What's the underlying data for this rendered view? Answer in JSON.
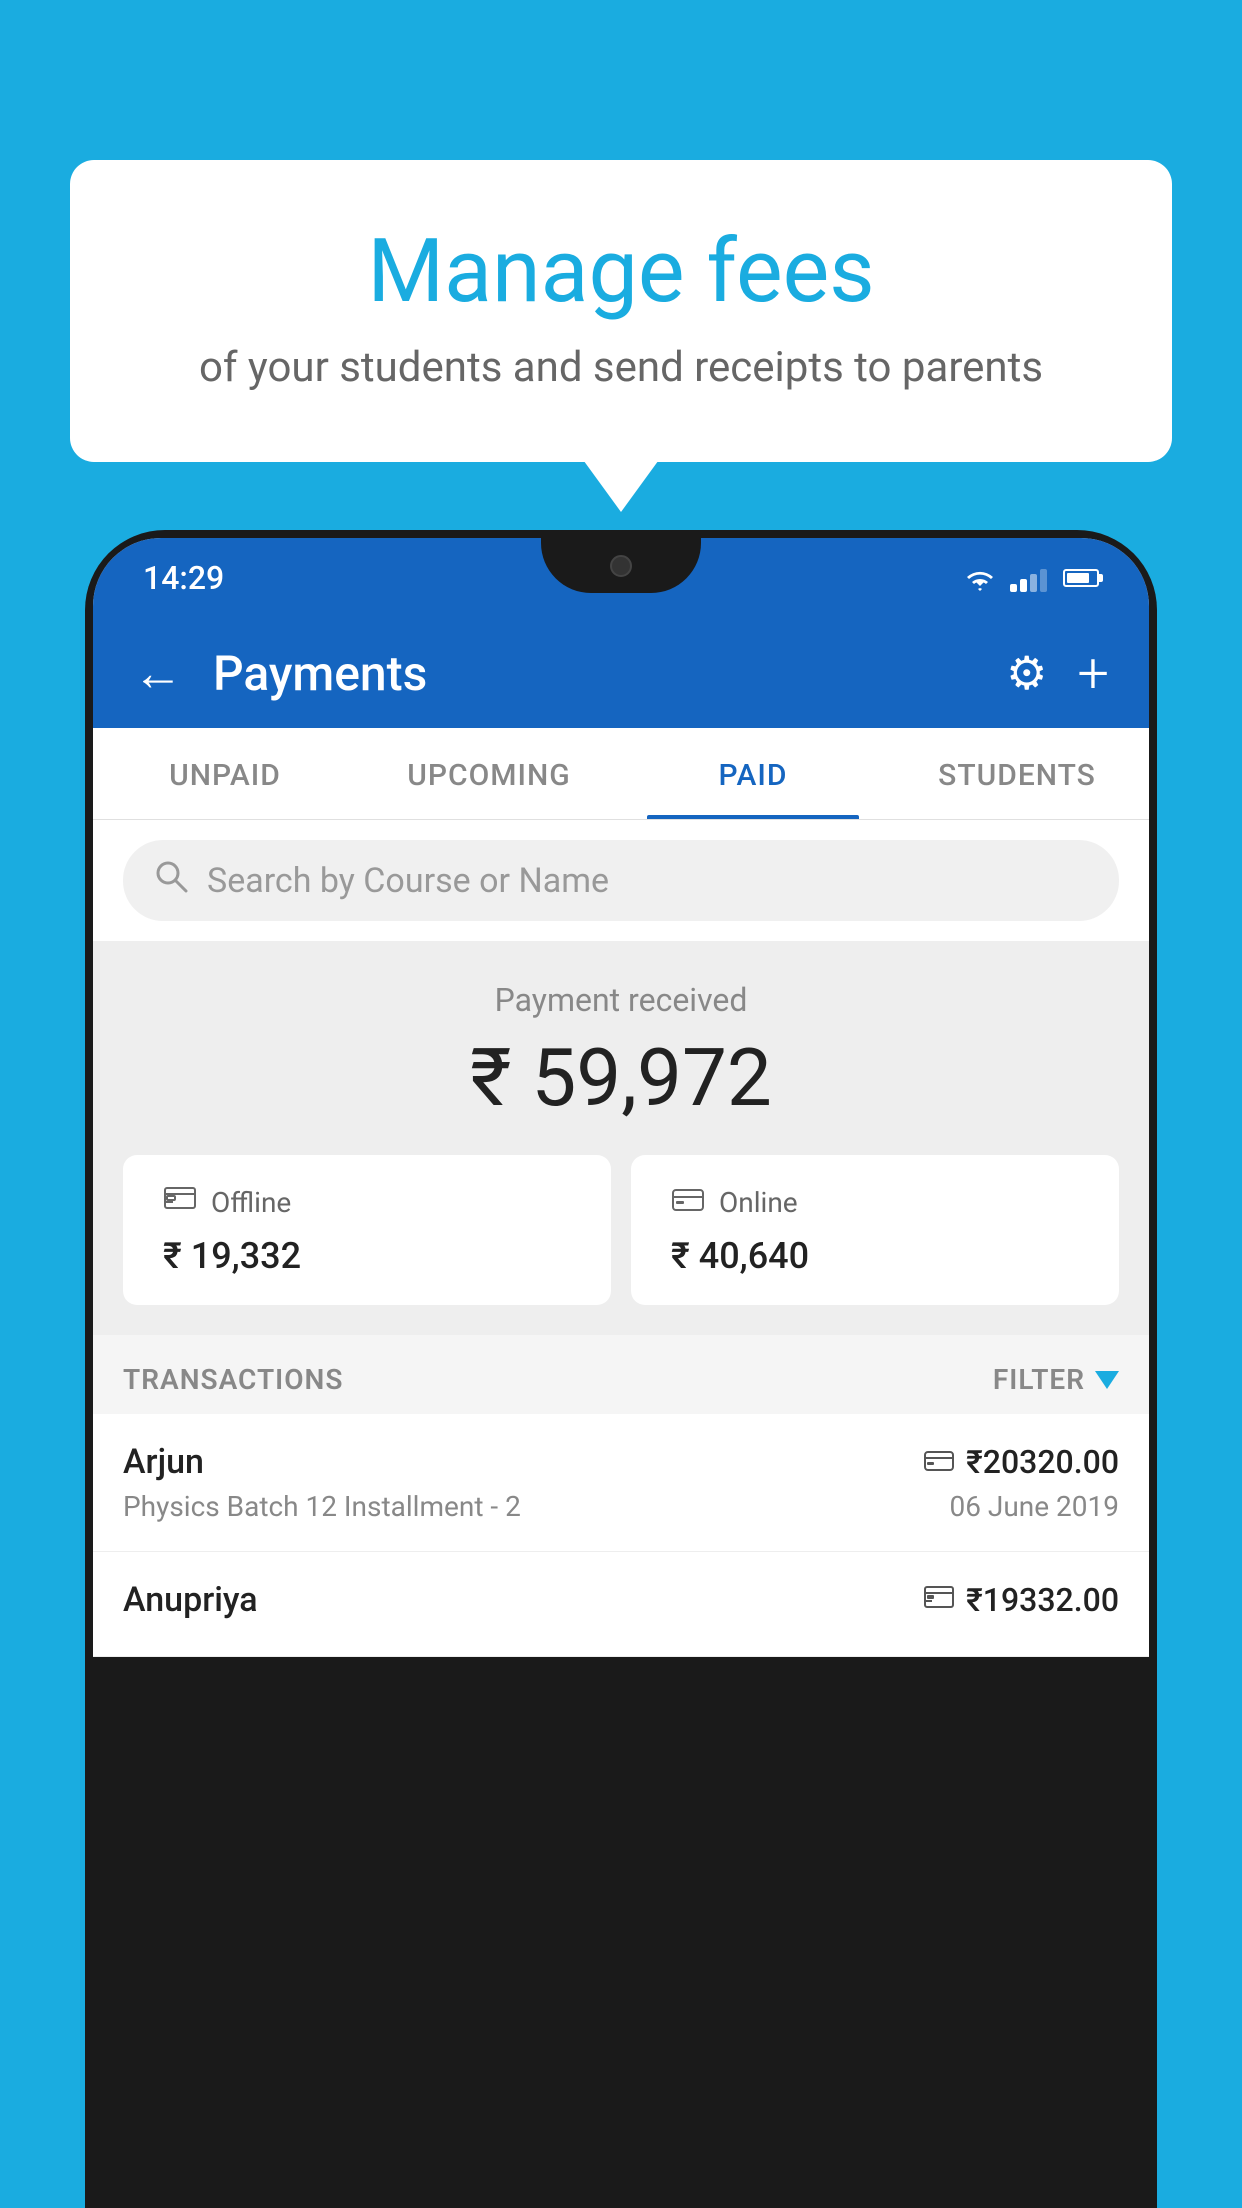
{
  "background_color": "#1AACE0",
  "bubble": {
    "title": "Manage fees",
    "subtitle": "of your students and send receipts to parents"
  },
  "status_bar": {
    "time": "14:29"
  },
  "header": {
    "title": "Payments",
    "back_label": "←",
    "settings_label": "⚙",
    "add_label": "+"
  },
  "tabs": [
    {
      "label": "UNPAID",
      "active": false
    },
    {
      "label": "UPCOMING",
      "active": false
    },
    {
      "label": "PAID",
      "active": true
    },
    {
      "label": "STUDENTS",
      "active": false
    }
  ],
  "search": {
    "placeholder": "Search by Course or Name"
  },
  "payment_section": {
    "label": "Payment received",
    "total": "₹ 59,972",
    "offline_label": "Offline",
    "offline_amount": "₹ 19,332",
    "online_label": "Online",
    "online_amount": "₹ 40,640"
  },
  "transactions": {
    "header": "TRANSACTIONS",
    "filter": "FILTER",
    "rows": [
      {
        "name": "Arjun",
        "course": "Physics Batch 12 Installment - 2",
        "amount": "₹20320.00",
        "date": "06 June 2019",
        "payment_type": "card"
      },
      {
        "name": "Anupriya",
        "course": "",
        "amount": "₹19332.00",
        "date": "",
        "payment_type": "cash"
      }
    ]
  }
}
